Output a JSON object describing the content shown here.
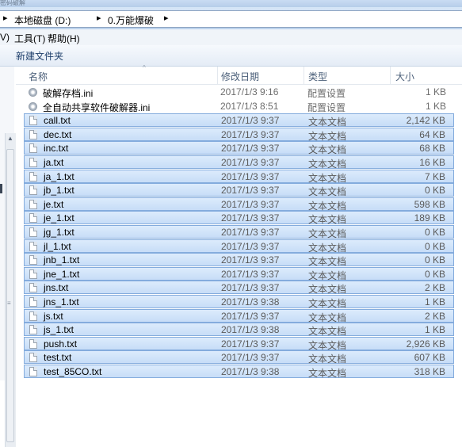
{
  "window": {
    "title_fragment": "密码破解"
  },
  "address": {
    "segments": [
      "本地磁盘 (D:)",
      "0.万能爆破"
    ]
  },
  "menu": {
    "items": [
      "V)",
      "工具(T)",
      "帮助(H)"
    ]
  },
  "toolbar": {
    "new_folder": "新建文件夹"
  },
  "columns": {
    "name": "名称",
    "date": "修改日期",
    "type": "类型",
    "size": "大小"
  },
  "files": [
    {
      "name": "破解存档.ini",
      "date": "2017/1/3 9:16",
      "type": "配置设置",
      "size": "1 KB",
      "icon": "ini-gear-icon",
      "selected": false
    },
    {
      "name": "全自动共享软件破解器.ini",
      "date": "2017/1/3 8:51",
      "type": "配置设置",
      "size": "1 KB",
      "icon": "ini-gear-icon",
      "selected": false
    },
    {
      "name": "call.txt",
      "date": "2017/1/3 9:37",
      "type": "文本文档",
      "size": "2,142 KB",
      "icon": "text-file-icon",
      "selected": true
    },
    {
      "name": "dec.txt",
      "date": "2017/1/3 9:37",
      "type": "文本文档",
      "size": "64 KB",
      "icon": "text-file-icon",
      "selected": true
    },
    {
      "name": "inc.txt",
      "date": "2017/1/3 9:37",
      "type": "文本文档",
      "size": "68 KB",
      "icon": "text-file-icon",
      "selected": true
    },
    {
      "name": "ja.txt",
      "date": "2017/1/3 9:37",
      "type": "文本文档",
      "size": "16 KB",
      "icon": "text-file-icon",
      "selected": true
    },
    {
      "name": "ja_1.txt",
      "date": "2017/1/3 9:37",
      "type": "文本文档",
      "size": "7 KB",
      "icon": "text-file-icon",
      "selected": true
    },
    {
      "name": "jb_1.txt",
      "date": "2017/1/3 9:37",
      "type": "文本文档",
      "size": "0 KB",
      "icon": "text-file-icon",
      "selected": true
    },
    {
      "name": "je.txt",
      "date": "2017/1/3 9:37",
      "type": "文本文档",
      "size": "598 KB",
      "icon": "text-file-icon",
      "selected": true
    },
    {
      "name": "je_1.txt",
      "date": "2017/1/3 9:37",
      "type": "文本文档",
      "size": "189 KB",
      "icon": "text-file-icon",
      "selected": true
    },
    {
      "name": "jg_1.txt",
      "date": "2017/1/3 9:37",
      "type": "文本文档",
      "size": "0 KB",
      "icon": "text-file-icon",
      "selected": true
    },
    {
      "name": "jl_1.txt",
      "date": "2017/1/3 9:37",
      "type": "文本文档",
      "size": "0 KB",
      "icon": "text-file-icon",
      "selected": true
    },
    {
      "name": "jnb_1.txt",
      "date": "2017/1/3 9:37",
      "type": "文本文档",
      "size": "0 KB",
      "icon": "text-file-icon",
      "selected": true
    },
    {
      "name": "jne_1.txt",
      "date": "2017/1/3 9:37",
      "type": "文本文档",
      "size": "0 KB",
      "icon": "text-file-icon",
      "selected": true
    },
    {
      "name": "jns.txt",
      "date": "2017/1/3 9:37",
      "type": "文本文档",
      "size": "2 KB",
      "icon": "text-file-icon",
      "selected": true
    },
    {
      "name": "jns_1.txt",
      "date": "2017/1/3 9:38",
      "type": "文本文档",
      "size": "1 KB",
      "icon": "text-file-icon",
      "selected": true
    },
    {
      "name": "js.txt",
      "date": "2017/1/3 9:37",
      "type": "文本文档",
      "size": "2 KB",
      "icon": "text-file-icon",
      "selected": true
    },
    {
      "name": "js_1.txt",
      "date": "2017/1/3 9:38",
      "type": "文本文档",
      "size": "1 KB",
      "icon": "text-file-icon",
      "selected": true
    },
    {
      "name": "push.txt",
      "date": "2017/1/3 9:37",
      "type": "文本文档",
      "size": "2,926 KB",
      "icon": "text-file-icon",
      "selected": true
    },
    {
      "name": "test.txt",
      "date": "2017/1/3 9:37",
      "type": "文本文档",
      "size": "607 KB",
      "icon": "text-file-icon",
      "selected": true
    },
    {
      "name": "test_85CO.txt",
      "date": "2017/1/3 9:38",
      "type": "文本文档",
      "size": "318 KB",
      "icon": "text-file-icon",
      "selected": true
    }
  ]
}
